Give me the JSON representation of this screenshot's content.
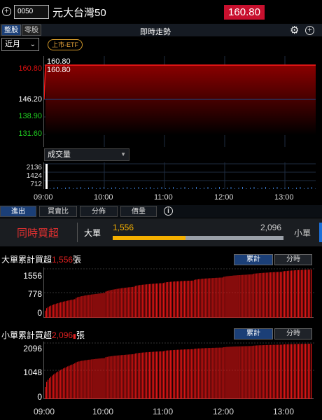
{
  "header": {
    "stock_code": "0050",
    "stock_name": "元大台灣50",
    "price": "160.80"
  },
  "toolbar": {
    "tab_whole": "整股",
    "tab_odd": "零股",
    "title": "即時走勢"
  },
  "controls": {
    "period_select": "近月",
    "etf_badge": "上市-ETF"
  },
  "price_chart": {
    "y_labels": [
      "160.80",
      "146.20",
      "138.90",
      "131.60"
    ],
    "tooltip_line1": "160.80",
    "tooltip_line2": "160.80",
    "colors": {
      "up": "#e01010",
      "ref": "#ffffff",
      "down": "#20d020",
      "line": "#e01010"
    }
  },
  "volume_chart": {
    "dropdown": "成交量",
    "y_labels": [
      "2136",
      "1424",
      "712"
    ]
  },
  "time_axis": [
    "09:00",
    "10:00",
    "11:00",
    "12:00",
    "13:00"
  ],
  "buttons": {
    "in_out": "進出",
    "buy_sell_ratio": "買賣比",
    "distribution": "分佈",
    "volume_price": "價量"
  },
  "same_time": {
    "label": "同時買超",
    "big_label": "大單",
    "big_value": "1,556",
    "small_value": "2,096",
    "small_label": "小單",
    "ratio": 0.4261
  },
  "big_chart": {
    "title_prefix": "大單累計買超",
    "title_value": "1,556",
    "title_suffix": "張",
    "seg_cumulative": "累計",
    "seg_period": "分時",
    "y_labels": [
      "1556",
      "778",
      "0"
    ]
  },
  "small_chart": {
    "title_prefix": "小單累計買超",
    "title_value": "2,096",
    "title_suffix": "張",
    "seg_cumulative": "累計",
    "seg_period": "分時",
    "y_labels": [
      "2096",
      "1048",
      "0"
    ]
  },
  "bottom_axis": [
    "09:00",
    "10:00",
    "11:00",
    "12:00",
    "13:00"
  ],
  "chart_data": [
    {
      "type": "area",
      "x": [
        "09:00",
        "09:01",
        "10:00",
        "11:00",
        "12:00",
        "13:00",
        "13:30"
      ],
      "values": [
        146.2,
        160.8,
        160.8,
        160.8,
        160.8,
        160.8,
        160.8
      ],
      "ylim": [
        131.6,
        160.8
      ],
      "title": "",
      "xlabel": "",
      "ylabel": ""
    },
    {
      "type": "bar",
      "x": [
        "09:00",
        "13:30"
      ],
      "values": [
        2136,
        0
      ],
      "ylim": [
        0,
        2136
      ],
      "title": "成交量"
    },
    {
      "type": "bar",
      "series": [
        {
          "name": "大單累計買超",
          "x": [
            "09:00",
            "09:30",
            "10:00",
            "10:30",
            "11:00",
            "11:30",
            "12:00",
            "12:30",
            "13:00",
            "13:30"
          ],
          "values": [
            230,
            600,
            800,
            1000,
            1120,
            1200,
            1300,
            1400,
            1480,
            1556
          ]
        }
      ],
      "ylim": [
        0,
        1556
      ]
    },
    {
      "type": "bar",
      "series": [
        {
          "name": "小單累計買超",
          "x": [
            "09:00",
            "09:30",
            "10:00",
            "10:30",
            "11:00",
            "11:30",
            "12:00",
            "12:30",
            "13:00",
            "13:30"
          ],
          "values": [
            450,
            1350,
            1550,
            1700,
            1810,
            1890,
            1950,
            2010,
            2060,
            2096
          ]
        }
      ],
      "ylim": [
        0,
        2096
      ]
    }
  ]
}
